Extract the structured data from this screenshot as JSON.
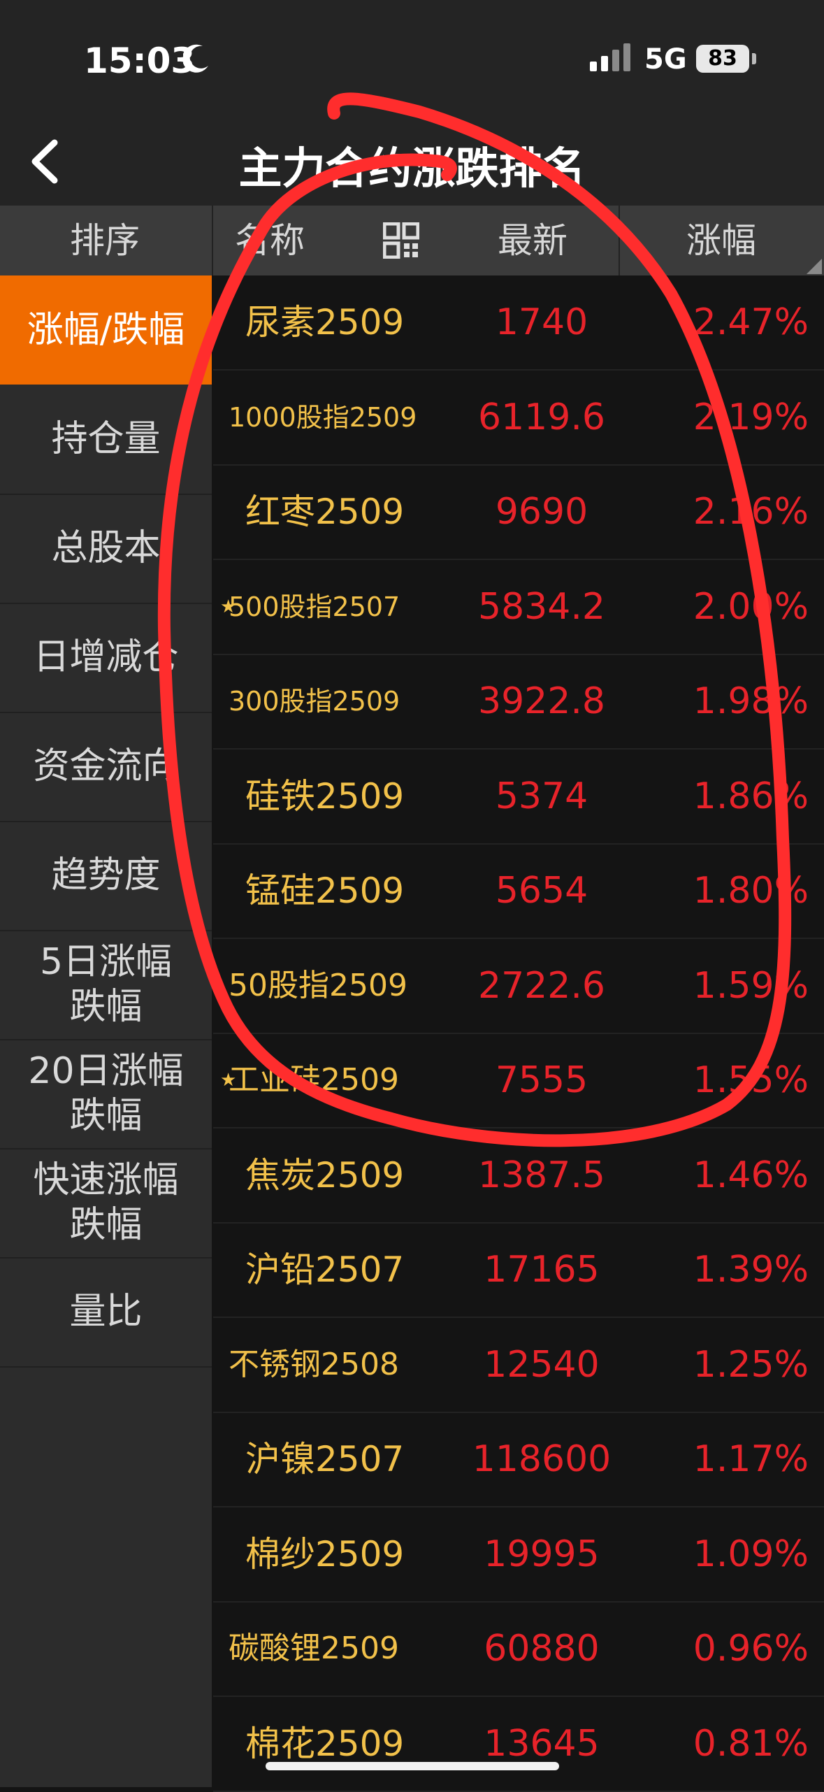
{
  "status_bar": {
    "time": "15:03",
    "network": "5G",
    "battery": "83"
  },
  "header": {
    "title": "主力合约涨跌排名"
  },
  "columns": {
    "sort": "排序",
    "name": "名称",
    "latest": "最新",
    "change": "涨幅"
  },
  "sidebar": {
    "items": [
      {
        "label": "涨幅/跌幅",
        "active": true
      },
      {
        "label": "持仓量"
      },
      {
        "label": "总股本"
      },
      {
        "label": "日增减仓"
      },
      {
        "label": "资金流向"
      },
      {
        "label": "趋势度"
      },
      {
        "label": "5日涨幅\n跌幅"
      },
      {
        "label": "20日涨幅\n跌幅"
      },
      {
        "label": "快速涨幅\n跌幅"
      },
      {
        "label": "量比"
      }
    ]
  },
  "rows": [
    {
      "name": "尿素2509",
      "price": "1740",
      "change": "2.47%"
    },
    {
      "name": "1000股指2509",
      "price": "6119.6",
      "change": "2.19%"
    },
    {
      "name": "红枣2509",
      "price": "9690",
      "change": "2.16%"
    },
    {
      "name": "500股指2507",
      "price": "5834.2",
      "change": "2.00%",
      "starred": true
    },
    {
      "name": "300股指2509",
      "price": "3922.8",
      "change": "1.98%"
    },
    {
      "name": "硅铁2509",
      "price": "5374",
      "change": "1.86%"
    },
    {
      "name": "锰硅2509",
      "price": "5654",
      "change": "1.80%"
    },
    {
      "name": "50股指2509",
      "price": "2722.6",
      "change": "1.59%"
    },
    {
      "name": "工业硅2509",
      "price": "7555",
      "change": "1.55%",
      "starred": true
    },
    {
      "name": "焦炭2509",
      "price": "1387.5",
      "change": "1.46%"
    },
    {
      "name": "沪铅2507",
      "price": "17165",
      "change": "1.39%"
    },
    {
      "name": "不锈钢2508",
      "price": "12540",
      "change": "1.25%"
    },
    {
      "name": "沪镍2507",
      "price": "118600",
      "change": "1.17%"
    },
    {
      "name": "棉纱2509",
      "price": "19995",
      "change": "1.09%"
    },
    {
      "name": "碳酸锂2509",
      "price": "60880",
      "change": "0.96%"
    },
    {
      "name": "棉花2509",
      "price": "13645",
      "change": "0.81%"
    }
  ],
  "icons": {
    "star": "★"
  },
  "colors": {
    "accent": "#f06b00",
    "name": "#f2c14a",
    "up": "#e8232a",
    "annotation": "#ff2d2d"
  }
}
